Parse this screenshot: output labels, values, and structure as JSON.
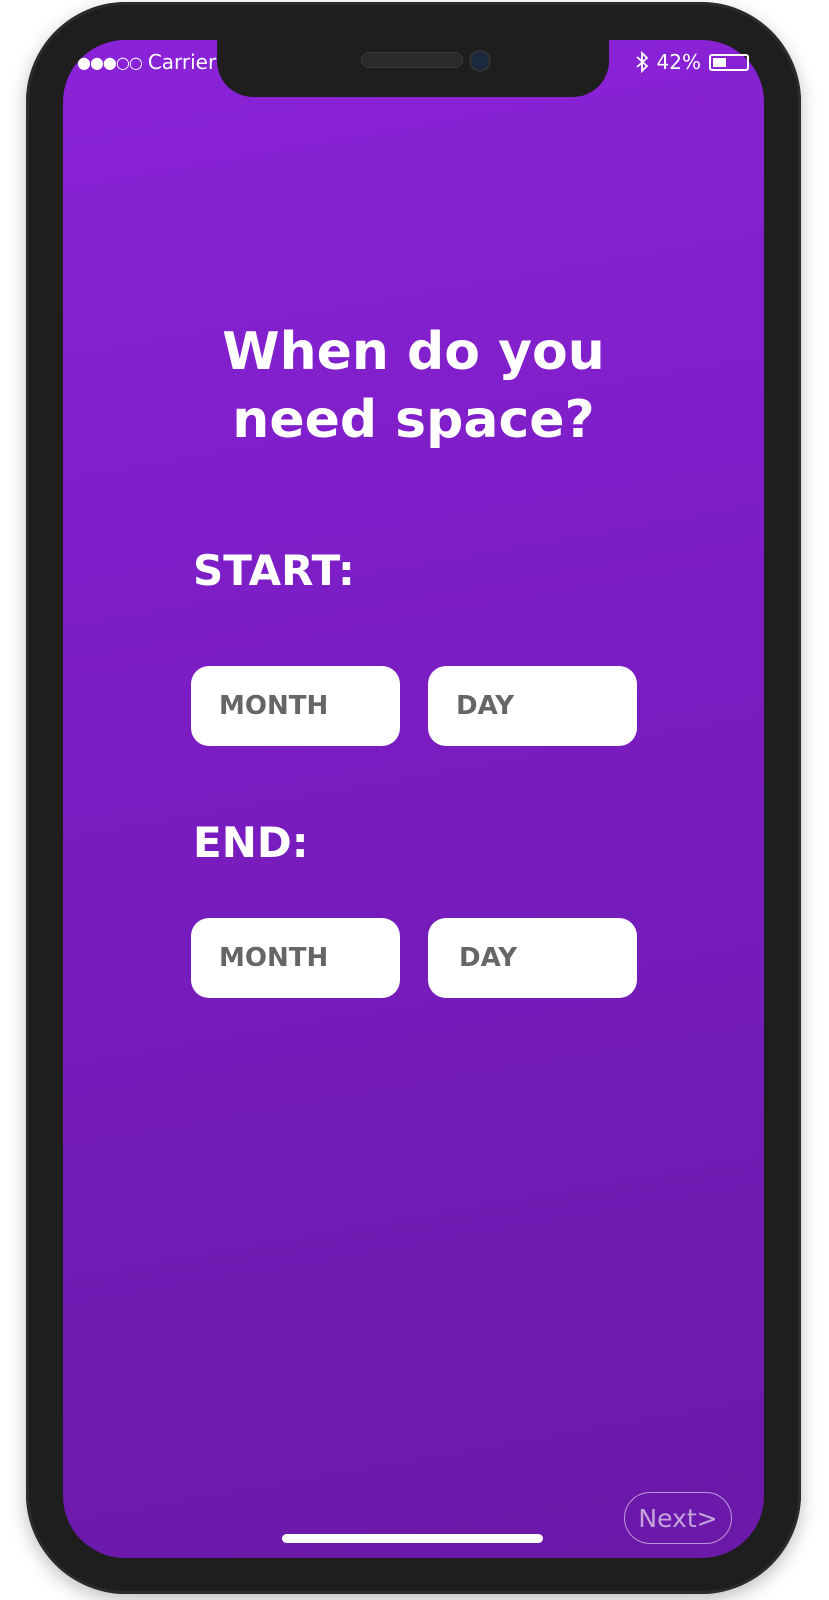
{
  "status_bar": {
    "signal": "●●●○○",
    "carrier": "Carrier",
    "battery_percent": "42%",
    "battery_level": 0.42
  },
  "title": {
    "line1": "When do you",
    "line2": "need space?"
  },
  "start": {
    "label": "START:",
    "month_placeholder": "MONTH",
    "day_placeholder": "DAY"
  },
  "end": {
    "label": "END:",
    "month_placeholder": "MONTH",
    "day_placeholder": "DAY"
  },
  "next_label": "Next>",
  "colors": {
    "background_top": "#8b23d8",
    "background_bottom": "#6a19a8",
    "field_text": "#666666"
  }
}
